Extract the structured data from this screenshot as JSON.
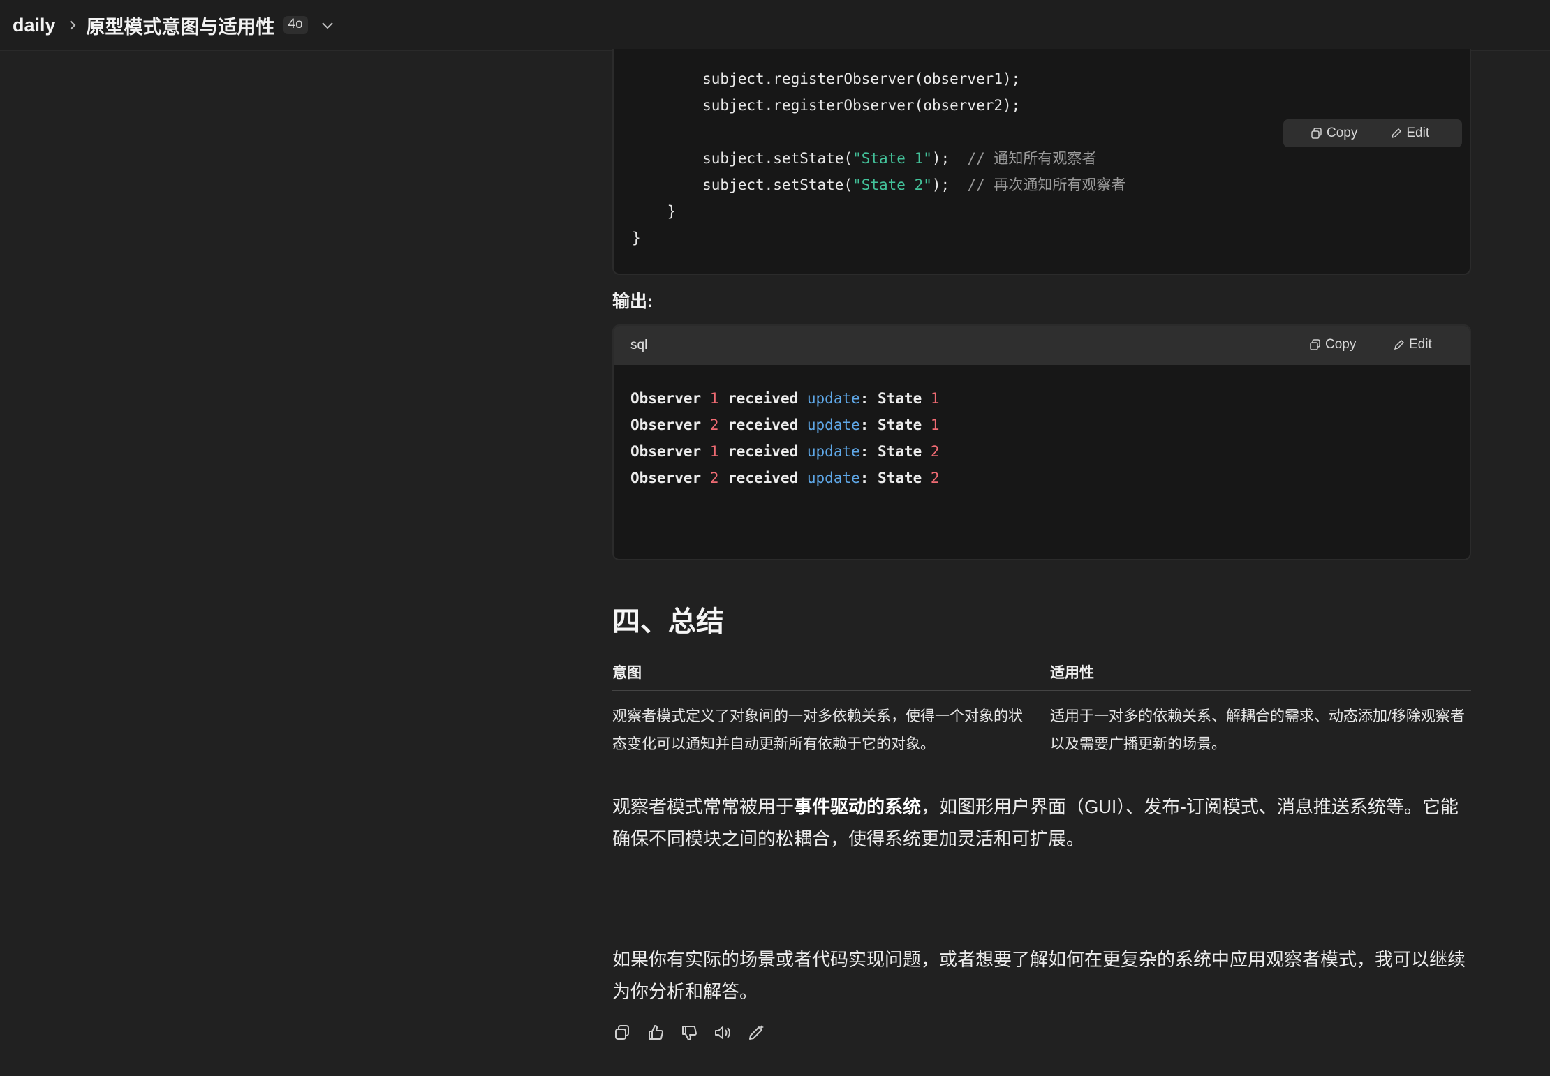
{
  "header": {
    "breadcrumb_root": "daily",
    "title": "原型模式意图与适用性",
    "model": "4o"
  },
  "code_block_1": {
    "lines": [
      [
        {
          "t": "        subject.registerObserver(observer1);",
          "c": ""
        }
      ],
      [
        {
          "t": "        subject.registerObserver(observer2);",
          "c": ""
        }
      ],
      [
        {
          "t": "",
          "c": ""
        }
      ],
      [
        {
          "t": "        subject.setState(",
          "c": ""
        },
        {
          "t": "\"State 1\"",
          "c": "str"
        },
        {
          "t": ");  ",
          "c": ""
        },
        {
          "t": "// 通知所有观察者",
          "c": "com"
        }
      ],
      [
        {
          "t": "        subject.setState(",
          "c": ""
        },
        {
          "t": "\"State 2\"",
          "c": "str"
        },
        {
          "t": ");  ",
          "c": ""
        },
        {
          "t": "// 再次通知所有观察者",
          "c": "com"
        }
      ],
      [
        {
          "t": "    }",
          "c": ""
        }
      ],
      [
        {
          "t": "}",
          "c": ""
        }
      ]
    ],
    "copy_label": "Copy",
    "edit_label": "Edit"
  },
  "output_label": "输出:",
  "code_block_2": {
    "language": "sql",
    "copy_label": "Copy",
    "edit_label": "Edit",
    "lines": [
      [
        {
          "t": "Observer ",
          "c": ""
        },
        {
          "t": "1",
          "c": "num"
        },
        {
          "t": " received ",
          "c": ""
        },
        {
          "t": "update",
          "c": "kw"
        },
        {
          "t": ": State ",
          "c": ""
        },
        {
          "t": "1",
          "c": "num"
        }
      ],
      [
        {
          "t": "Observer ",
          "c": ""
        },
        {
          "t": "2",
          "c": "num"
        },
        {
          "t": " received ",
          "c": ""
        },
        {
          "t": "update",
          "c": "kw"
        },
        {
          "t": ": State ",
          "c": ""
        },
        {
          "t": "1",
          "c": "num"
        }
      ],
      [
        {
          "t": "Observer ",
          "c": ""
        },
        {
          "t": "1",
          "c": "num"
        },
        {
          "t": " received ",
          "c": ""
        },
        {
          "t": "update",
          "c": "kw"
        },
        {
          "t": ": State ",
          "c": ""
        },
        {
          "t": "2",
          "c": "num"
        }
      ],
      [
        {
          "t": "Observer ",
          "c": ""
        },
        {
          "t": "2",
          "c": "num"
        },
        {
          "t": " received ",
          "c": ""
        },
        {
          "t": "update",
          "c": "kw"
        },
        {
          "t": ": State ",
          "c": ""
        },
        {
          "t": "2",
          "c": "num"
        }
      ]
    ]
  },
  "summary": {
    "heading": "四、总结",
    "table": {
      "headers": [
        "意图",
        "适用性"
      ],
      "rows": [
        [
          "观察者模式定义了对象间的一对多依赖关系，使得一个对象的状态变化可以通知并自动更新所有依赖于它的对象。",
          "适用于一对多的依赖关系、解耦合的需求、动态添加/移除观察者以及需要广播更新的场景。"
        ]
      ]
    },
    "paragraph_1": {
      "before": "观察者模式常常被用于",
      "bold": "事件驱动的系统",
      "after": "，如图形用户界面（GUI）、发布-订阅模式、消息推送系统等。它能确保不同模块之间的松耦合，使得系统更加灵活和可扩展。"
    },
    "paragraph_2": "如果你有实际的场景或者代码实现问题，或者想要了解如何在更复杂的系统中应用观察者模式，我可以继续为你分析和解答。"
  },
  "colors": {
    "background": "#212121",
    "code_background": "#171717",
    "string": "#43c29a",
    "comment": "#9a9a9a",
    "number": "#ef6b73",
    "keyword": "#5fa8e8"
  },
  "reaction_icons": [
    "copy-icon",
    "thumbs-up-icon",
    "thumbs-down-icon",
    "read-aloud-icon",
    "edit-icon"
  ]
}
